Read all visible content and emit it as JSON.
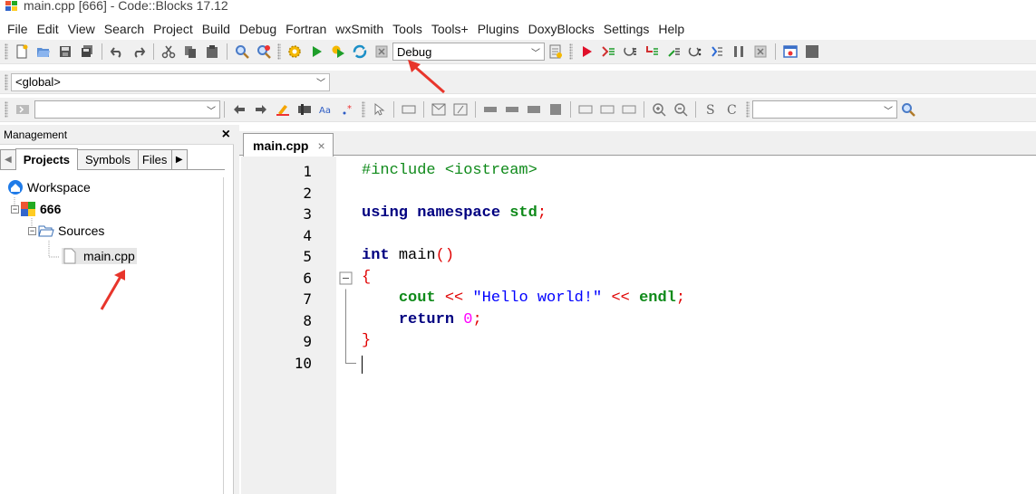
{
  "window": {
    "title": "main.cpp [666] - Code::Blocks 17.12"
  },
  "menu": [
    "File",
    "Edit",
    "View",
    "Search",
    "Project",
    "Build",
    "Debug",
    "Fortran",
    "wxSmith",
    "Tools",
    "Tools+",
    "Plugins",
    "DoxyBlocks",
    "Settings",
    "Help"
  ],
  "toolbar": {
    "build_target": "Debug"
  },
  "scope": {
    "value": "<global>"
  },
  "management": {
    "title": "Management",
    "close": "×",
    "tabs": [
      "Projects",
      "Symbols",
      "Files"
    ],
    "tree": {
      "workspace": "Workspace",
      "project": "666",
      "sources": "Sources",
      "file": "main.cpp"
    }
  },
  "editor": {
    "tab_label": "main.cpp",
    "tab_close": "×",
    "line_numbers": [
      "1",
      "2",
      "3",
      "4",
      "5",
      "6",
      "7",
      "8",
      "9",
      "10"
    ],
    "lines": [
      [
        {
          "t": "#include <iostream>",
          "c": "green"
        }
      ],
      [],
      [
        {
          "t": "using namespace ",
          "c": "navy"
        },
        {
          "t": "std",
          "c": "green-b"
        },
        {
          "t": ";",
          "c": "red"
        }
      ],
      [],
      [
        {
          "t": "int ",
          "c": "navy"
        },
        {
          "t": "main",
          "c": "plain"
        },
        {
          "t": "()",
          "c": "red"
        }
      ],
      [
        {
          "t": "{",
          "c": "red"
        }
      ],
      [
        {
          "t": "    "
        },
        {
          "t": "cout",
          "c": "green-b"
        },
        {
          "t": " << ",
          "c": "red"
        },
        {
          "t": "\"Hello world!\"",
          "c": "blue"
        },
        {
          "t": " << ",
          "c": "red"
        },
        {
          "t": "endl",
          "c": "green-b"
        },
        {
          "t": ";",
          "c": "red"
        }
      ],
      [
        {
          "t": "    "
        },
        {
          "t": "return ",
          "c": "navy"
        },
        {
          "t": "0",
          "c": "mag"
        },
        {
          "t": ";",
          "c": "red"
        }
      ],
      [
        {
          "t": "}",
          "c": "red"
        }
      ],
      []
    ]
  },
  "colors": {
    "annotation_arrow": "#e8352b",
    "keyword": "#000080",
    "preprocessor": "#0f8a1a",
    "string": "#0000ff",
    "operator": "#e00000",
    "number": "#ff00ff"
  }
}
